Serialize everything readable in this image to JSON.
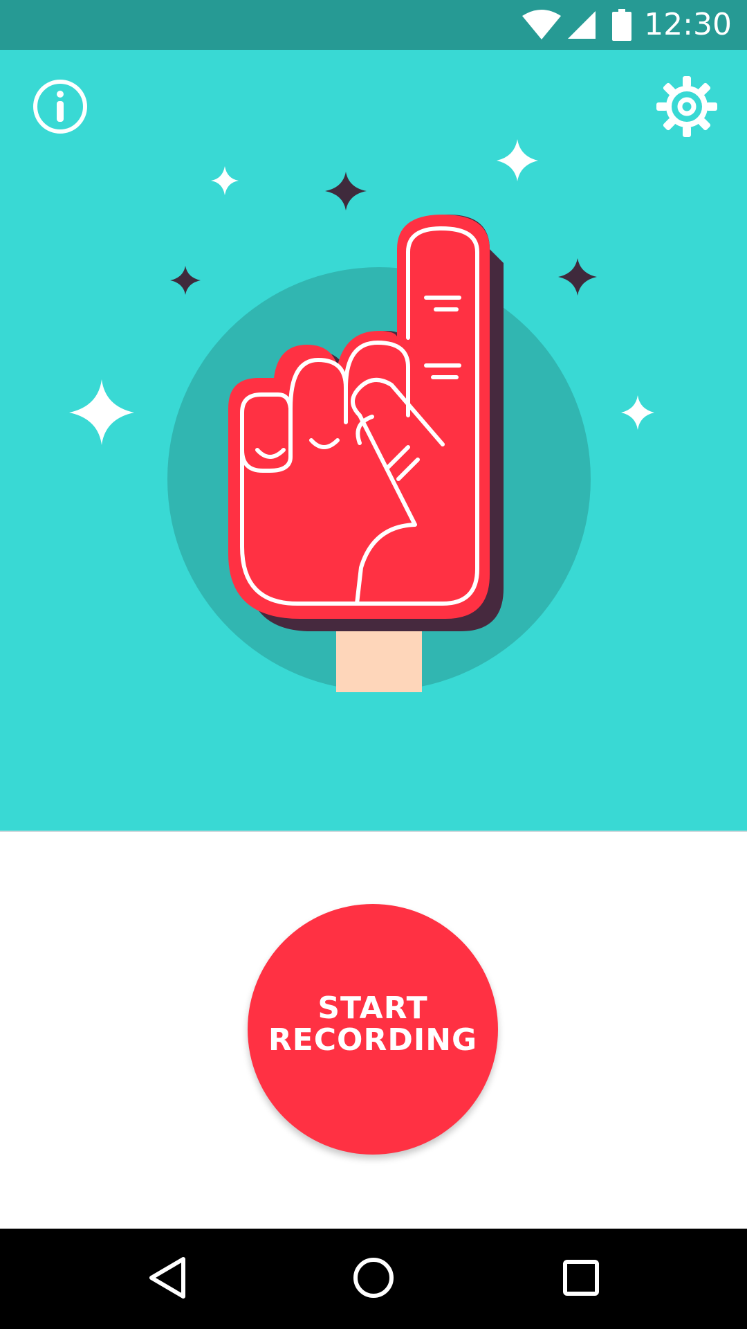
{
  "status_bar": {
    "time": "12:30",
    "background_color": "#269A94",
    "icons": [
      "wifi-icon",
      "cell-signal-icon",
      "battery-icon"
    ]
  },
  "hero": {
    "background_color": "#39D9D4",
    "info_icon": "info-icon",
    "settings_icon": "gear-icon",
    "illustration": "foam-finger-illustration",
    "accent_color": "#FF3143"
  },
  "record_button": {
    "line1": "START",
    "line2": "RECORDING",
    "color": "#FF3143"
  },
  "nav_bar": {
    "icons": [
      "back-icon",
      "home-icon",
      "recents-icon"
    ]
  }
}
